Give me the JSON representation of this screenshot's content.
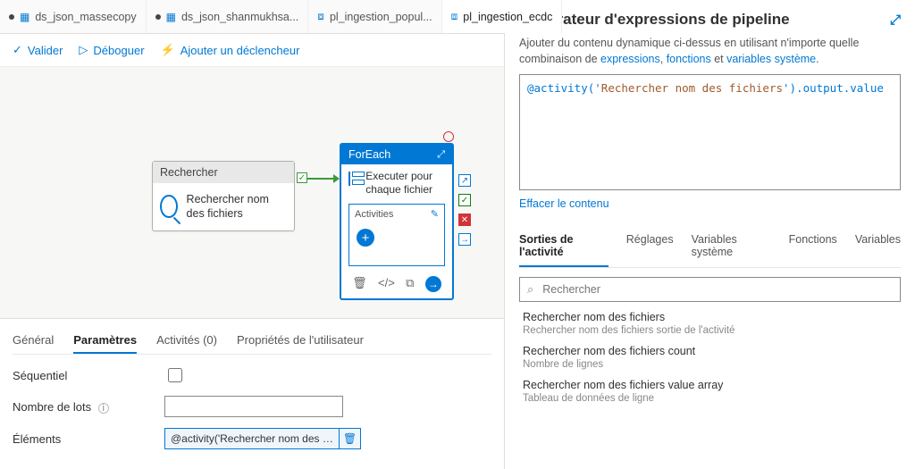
{
  "tabs": [
    {
      "label": "ds_json_massecopy"
    },
    {
      "label": "ds_json_shanmukhsa..."
    },
    {
      "label": "pl_ingestion_popul..."
    },
    {
      "label": "pl_ingestion_ecdc",
      "active": true
    }
  ],
  "toolbar": {
    "validate": "Valider",
    "debug": "Déboguer",
    "trigger": "Ajouter un déclencheur"
  },
  "canvas": {
    "lookup": {
      "header": "Rechercher",
      "label": "Rechercher nom des fichiers"
    },
    "foreach": {
      "header": "ForEach",
      "label": "Executer pour chaque fichier",
      "activities_label": "Activities"
    }
  },
  "props": {
    "tabs": {
      "general": "Général",
      "parameters": "Paramètres",
      "activities": "Activités (0)",
      "userprops": "Propriétés de l'utilisateur"
    },
    "sequential": "Séquentiel",
    "batch": "Nombre de lots",
    "elements": "Éléments",
    "elements_value": "@activity('Rechercher nom des fichie..."
  },
  "right": {
    "title": "Générateur d'expressions de pipeline",
    "help1": "Ajouter du contenu dynamique ci-dessus en utilisant n'importe quelle combinaison de ",
    "help_expr": "expressions",
    "help_fn": "fonctions",
    "help_and": " et ",
    "help_sv": "variables système",
    "expression": "@activity('Rechercher nom des fichiers').output.value",
    "clear": "Effacer le contenu",
    "tabs": {
      "outputs": "Sorties de l'activité",
      "settings": "Réglages",
      "sysvars": "Variables système",
      "functions": "Fonctions",
      "variables": "Variables"
    },
    "search_placeholder": "Rechercher",
    "items": [
      {
        "l1": "Rechercher nom des fichiers",
        "l2": "Rechercher nom des fichiers sortie de l'activité"
      },
      {
        "l1": "Rechercher nom des fichiers count",
        "l2": "Nombre de lignes"
      },
      {
        "l1": "Rechercher nom des fichiers value array",
        "l2": "Tableau de données de ligne"
      }
    ]
  }
}
